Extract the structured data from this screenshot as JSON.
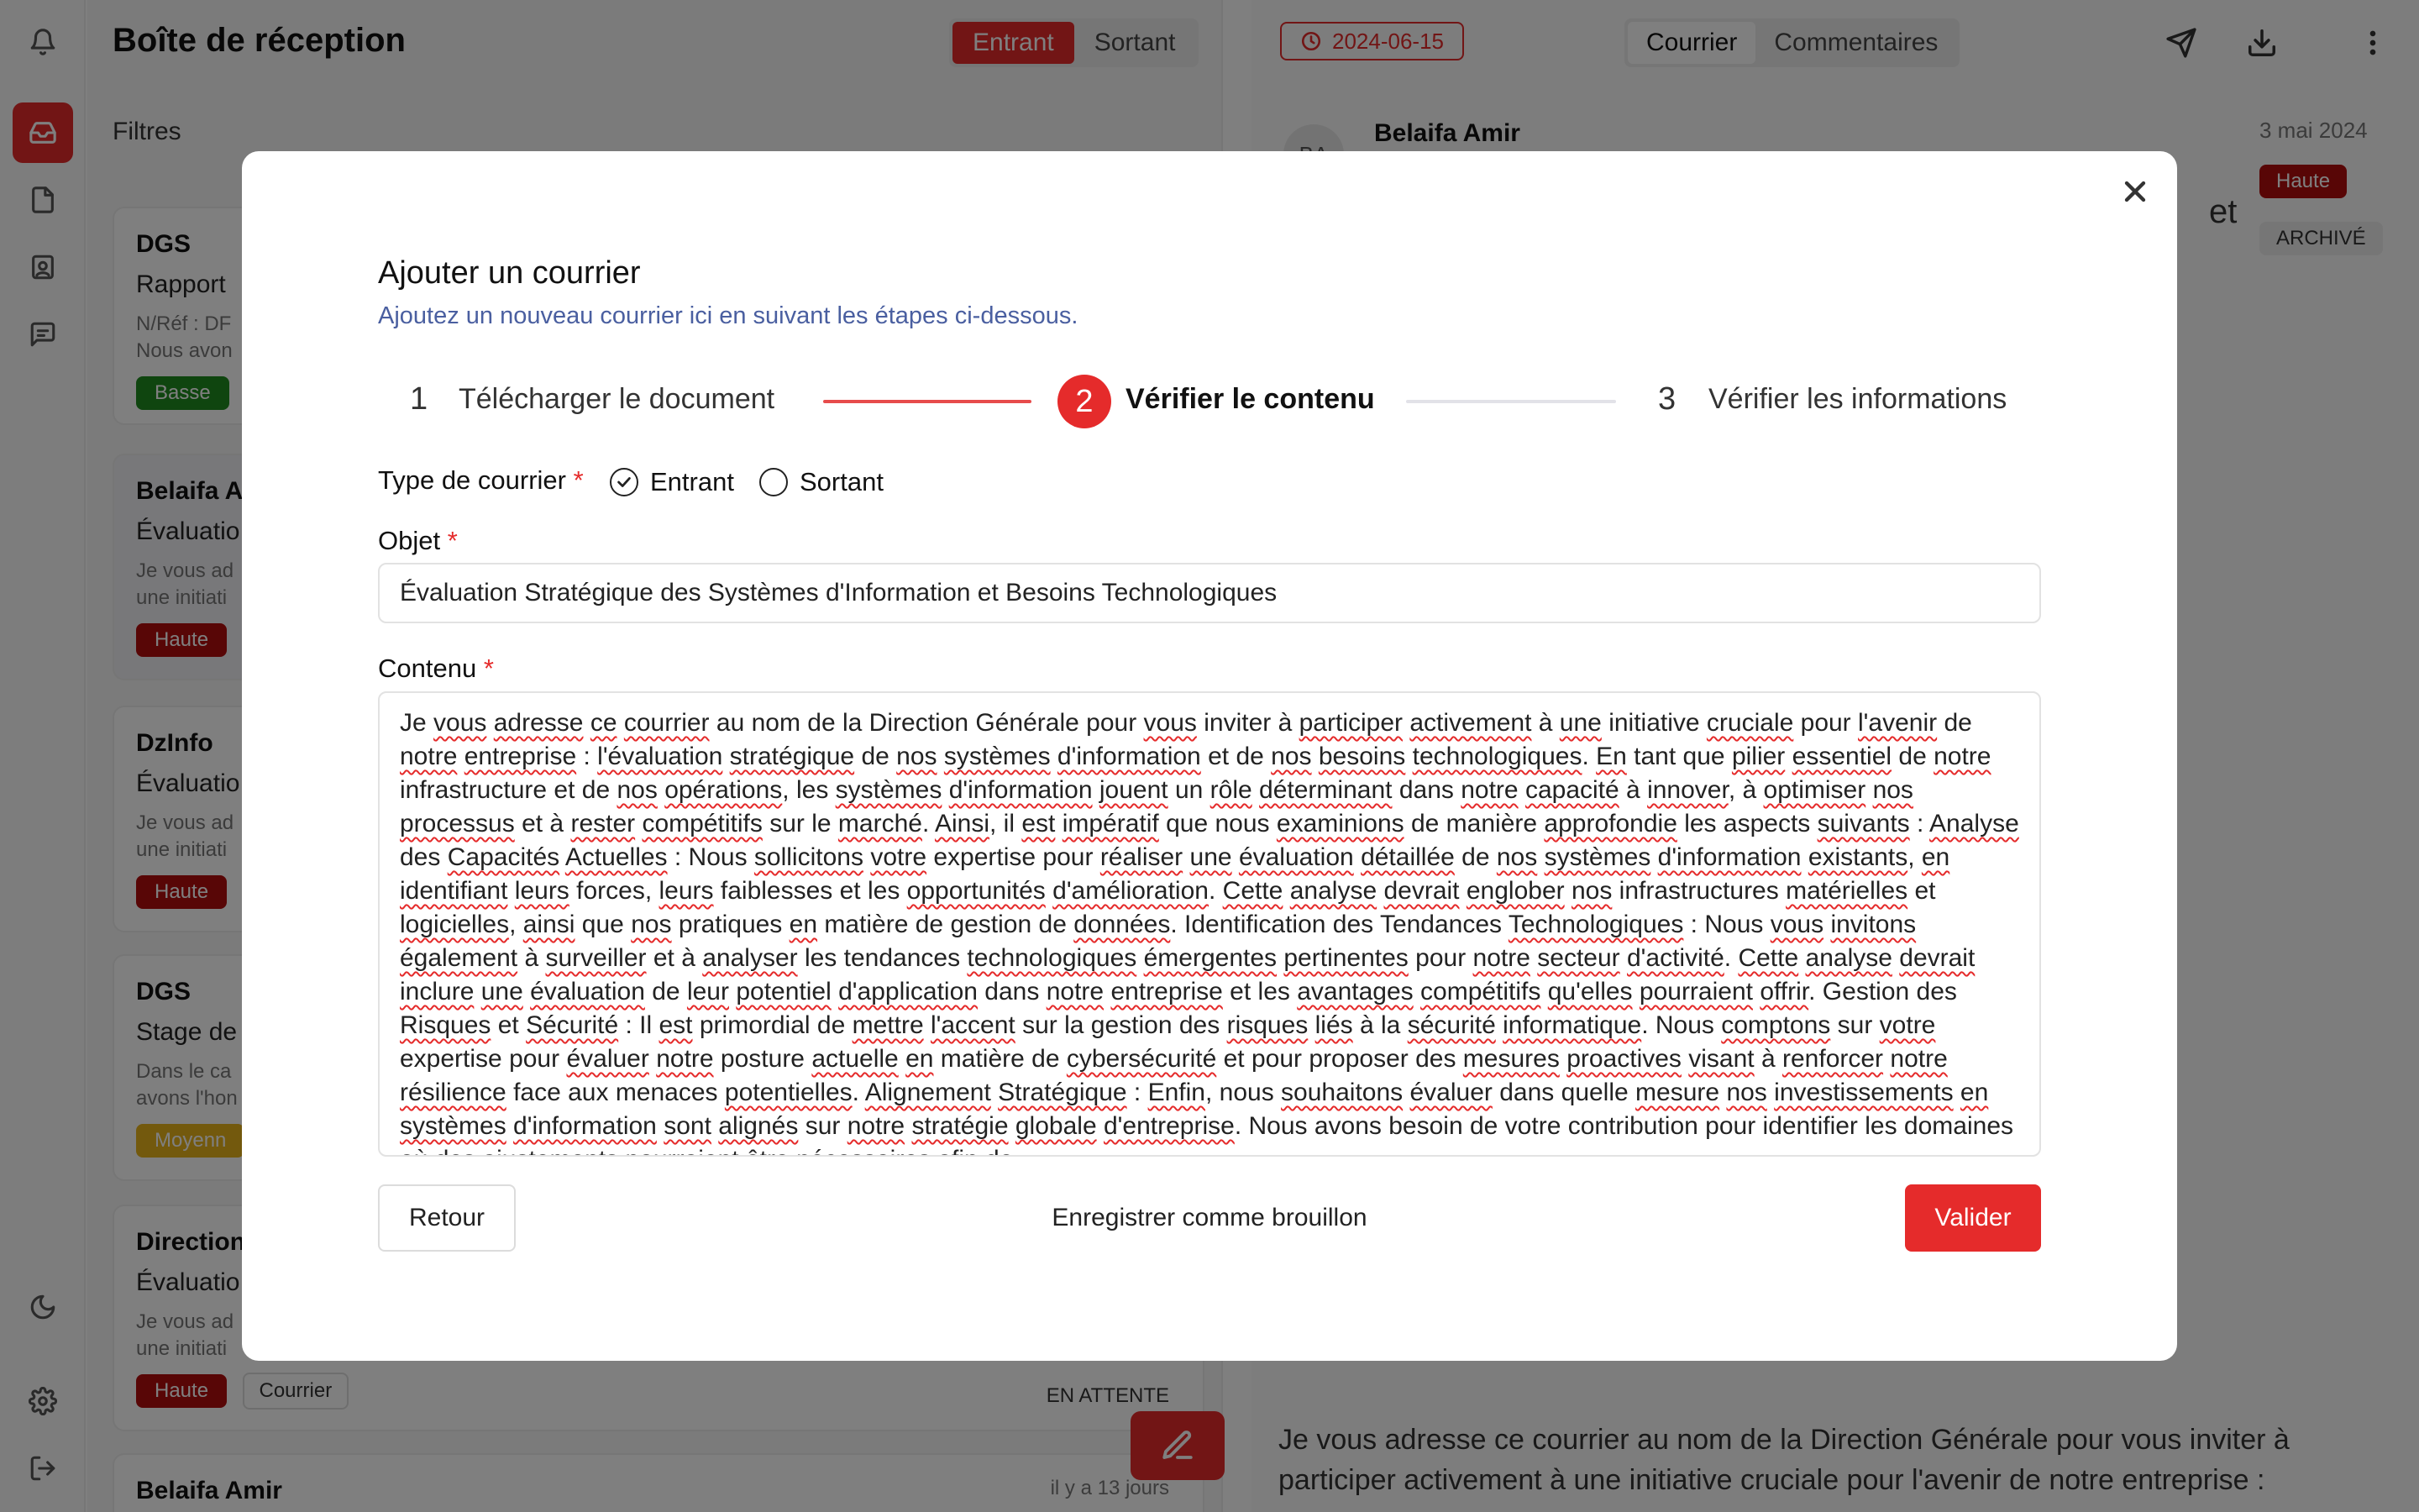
{
  "app": {
    "list_title": "Boîte de réception",
    "seg_in": "Entrant",
    "seg_out": "Sortant",
    "filters": "Filtres"
  },
  "rail": {
    "icons": [
      "bell-icon",
      "inbox-icon",
      "document-icon",
      "clipboard-user-icon",
      "chat-icon",
      "moon-icon",
      "gear-icon",
      "logout-icon"
    ]
  },
  "cards": [
    {
      "from": "DGS",
      "subj": "Rapport",
      "snip1": "N/Réf : DF",
      "snip2": "Nous avon",
      "badge": "Basse"
    },
    {
      "from": "Belaifa A",
      "subj": "Évaluatio",
      "snip1": "Je vous ad",
      "snip2": "une initiati",
      "badge": "Haute"
    },
    {
      "from": "DzInfo",
      "subj": "Évaluatio",
      "snip1": "Je vous ad",
      "snip2": "une initiati",
      "badge": "Haute"
    },
    {
      "from": "DGS",
      "subj": "Stage de",
      "snip1": "Dans le ca",
      "snip2": "avons l'hon",
      "badge": "Moyenn"
    },
    {
      "from": "Direction",
      "subj": "Évaluatio",
      "snip1": "Je vous ad",
      "snip2": "une initiati",
      "badge": "Haute",
      "tag": "Courrier",
      "status": "EN ATTENTE"
    },
    {
      "from": "Belaifa Amir",
      "time": "il y a 13 jours"
    }
  ],
  "right": {
    "date": "2024-06-15",
    "tab_mail": "Courrier",
    "tab_comments": "Commentaires",
    "avatar": "BA",
    "sender": "Belaifa Amir",
    "sent_date": "3 mai 2024",
    "priority": "Haute",
    "status": "ARCHIVÉ",
    "subject_tail": "et",
    "body": "Je vous adresse ce courrier au nom de la Direction Générale pour vous inviter à participer activement à une initiative cruciale pour l'avenir de notre entreprise :"
  },
  "modal": {
    "title": "Ajouter un courrier",
    "subtitle": "Ajoutez un nouveau courrier ici en suivant les étapes ci-dessous.",
    "steps": [
      {
        "num": "1",
        "label": "Télécharger le document"
      },
      {
        "num": "2",
        "label": "Vérifier le contenu"
      },
      {
        "num": "3",
        "label": "Vérifier les informations"
      }
    ],
    "type_label": "Type de courrier",
    "required_mark": "*",
    "radio_in": "Entrant",
    "radio_out": "Sortant",
    "objet_label": "Objet",
    "objet_value": "Évaluation Stratégique des Systèmes d'Information et Besoins Technologiques",
    "contenu_label": "Contenu",
    "btn_back": "Retour",
    "btn_draft": "Enregistrer comme brouillon",
    "btn_submit": "Valider"
  },
  "colors": {
    "accent": "#e52b2b",
    "overlay": "rgba(0,0,0,0.5)",
    "subtitle": "#4a5fa0"
  }
}
